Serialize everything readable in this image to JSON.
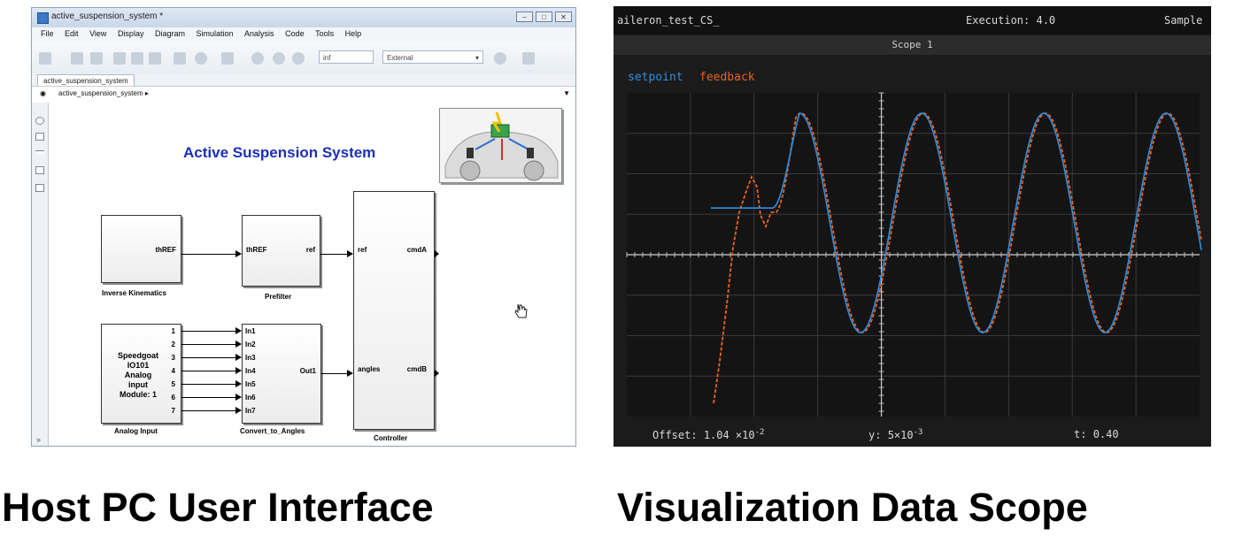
{
  "left_panel": {
    "window_title": "active_suspension_system *",
    "menu": [
      "File",
      "Edit",
      "View",
      "Display",
      "Diagram",
      "Simulation",
      "Analysis",
      "Code",
      "Tools",
      "Help"
    ],
    "stop_time": "inf",
    "mode": "External",
    "tab_label": "active_suspension_system",
    "breadcrumb": "active_suspension_system ▸",
    "model_title": "Active Suspension System",
    "blocks": {
      "inverse_kinematics": {
        "caption": "Inverse Kinematics",
        "out_port": "thREF"
      },
      "prefilter": {
        "caption": "Prefilter",
        "in_port": "thREF",
        "out_port": "ref"
      },
      "controller": {
        "caption": "Controller",
        "in_ports": [
          "ref",
          "angles"
        ],
        "out_ports": [
          "cmdA",
          "cmdB"
        ]
      },
      "analog_input": {
        "caption": "Analog Input",
        "text_lines": [
          "Speedgoat",
          "IO101",
          "Analog input",
          "Module: 1"
        ],
        "port_numbers": [
          "1",
          "2",
          "3",
          "4",
          "5",
          "6",
          "7"
        ]
      },
      "convert_to_angles": {
        "caption": "Convert_to_Angles",
        "in_ports": [
          "In1",
          "In2",
          "In3",
          "In4",
          "In5",
          "In6",
          "In7"
        ],
        "out_port": "Out1"
      }
    }
  },
  "scope": {
    "header_left": "aileron_test_CS_",
    "header_mid": "Execution: 4.0",
    "header_right": "Sample",
    "scope_title": "Scope 1",
    "legend": [
      {
        "label": "setpoint",
        "color": "#2f8fe0"
      },
      {
        "label": "feedback",
        "color": "#e8631f"
      }
    ],
    "footer": {
      "offset_label": "Offset:",
      "offset_value": "1.04 ×10",
      "offset_exp": "-2",
      "y_label": "y:",
      "y_value": "5×10",
      "y_exp": "-3",
      "t_label": "t:",
      "t_value": "0.40"
    },
    "chart_data": {
      "type": "line",
      "title": "Scope 1",
      "series": [
        {
          "name": "setpoint",
          "color": "#2f8fe0",
          "description_points": [
            [
              0.0,
              0.33
            ],
            [
              0.07,
              0.33
            ],
            [
              0.14,
              1.0
            ],
            [
              0.29,
              -0.55
            ],
            [
              0.44,
              1.0
            ],
            [
              0.59,
              -0.55
            ],
            [
              0.74,
              1.0
            ],
            [
              0.89,
              -0.55
            ],
            [
              1.0,
              0.45
            ]
          ]
        },
        {
          "name": "feedback",
          "color": "#e8631f",
          "description_points": [
            [
              0.0,
              -1.25
            ],
            [
              0.045,
              0.55
            ],
            [
              0.07,
              0.33
            ],
            [
              0.14,
              1.0
            ],
            [
              0.29,
              -0.55
            ],
            [
              0.44,
              1.0
            ],
            [
              0.59,
              -0.55
            ],
            [
              0.74,
              1.0
            ],
            [
              0.89,
              -0.55
            ],
            [
              1.0,
              0.45
            ]
          ]
        }
      ],
      "grid": true
    }
  },
  "captions": {
    "left": "Host PC User Interface",
    "right": "Visualization Data Scope"
  }
}
